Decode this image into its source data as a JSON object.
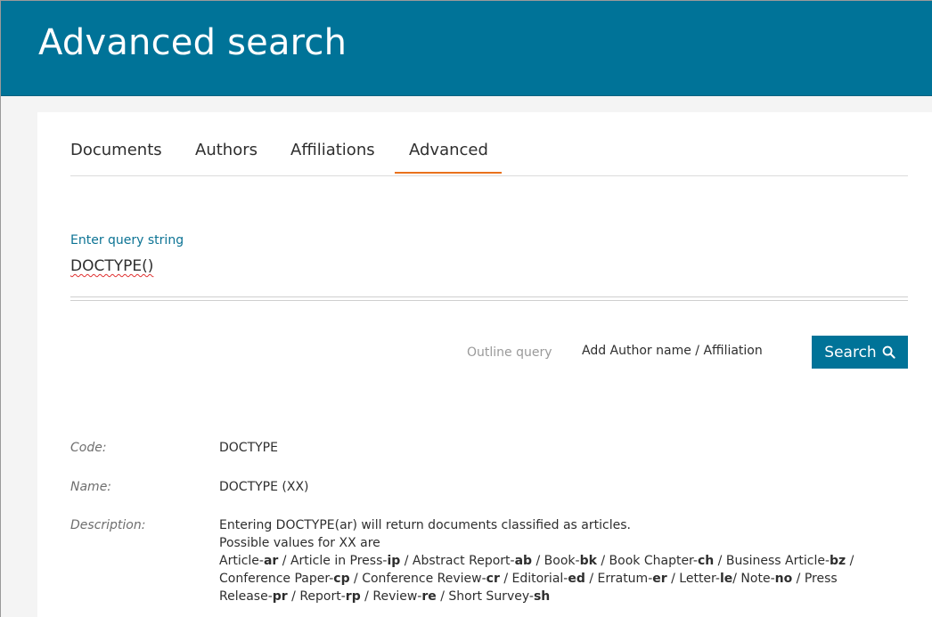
{
  "header": {
    "title": "Advanced search"
  },
  "tabs": [
    {
      "label": "Documents",
      "active": false
    },
    {
      "label": "Authors",
      "active": false
    },
    {
      "label": "Affiliations",
      "active": false
    },
    {
      "label": "Advanced",
      "active": true
    }
  ],
  "query": {
    "label": "Enter query string",
    "value": "DOCTYPE()"
  },
  "actions": {
    "outline_query": "Outline query",
    "add_author": "Add Author name / Affiliation",
    "search_label": "Search",
    "search_icon": "search-icon"
  },
  "info": {
    "code_key": "Code:",
    "code_value": "DOCTYPE",
    "name_key": "Name:",
    "name_value": "DOCTYPE (XX)",
    "description_key": "Description:",
    "description_line1": "Entering DOCTYPE(ar) will return documents classified as articles.",
    "description_line2": "Possible values for XX are",
    "values": [
      {
        "name": "Article-",
        "code": "ar",
        "sep": " / "
      },
      {
        "name": "Article in Press-",
        "code": "ip",
        "sep": " / "
      },
      {
        "name": "Abstract Report-",
        "code": "ab",
        "sep": " / "
      },
      {
        "name": "Book-",
        "code": "bk",
        "sep": " / "
      },
      {
        "name": "Book Chapter-",
        "code": "ch",
        "sep": " / "
      },
      {
        "name": "Business Article-",
        "code": "bz",
        "sep": " /"
      },
      {
        "name": "Conference Paper-",
        "code": "cp",
        "sep": " / "
      },
      {
        "name": "Conference Review-",
        "code": "cr",
        "sep": " / "
      },
      {
        "name": "Editorial-",
        "code": "ed",
        "sep": " / "
      },
      {
        "name": "Erratum-",
        "code": "er",
        "sep": " / "
      },
      {
        "name": "Letter-",
        "code": "le",
        "sep": "/ "
      },
      {
        "name": "Note-",
        "code": "no",
        "sep": " / Press"
      },
      {
        "name": "Release-",
        "code": "pr",
        "sep": " / "
      },
      {
        "name": "Report-",
        "code": "rp",
        "sep": " / "
      },
      {
        "name": "Review-",
        "code": "re",
        "sep": " / "
      },
      {
        "name": "Short Survey-",
        "code": "sh",
        "sep": ""
      }
    ]
  },
  "colors": {
    "header_bg": "#007398",
    "accent_underline": "#e9711c",
    "label_blue": "#0c7394"
  }
}
